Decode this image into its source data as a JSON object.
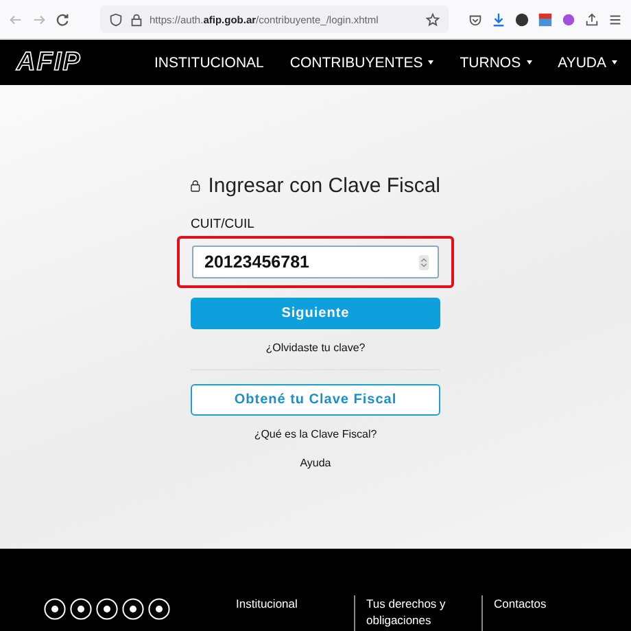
{
  "browser": {
    "url": "https://auth.**afip.gob.ar**/contribuyente_/login.xhtml"
  },
  "nav": {
    "logo": "AFIP",
    "items": [
      {
        "label": "INSTITUCIONAL",
        "dropdown": false
      },
      {
        "label": "CONTRIBUYENTES",
        "dropdown": true
      },
      {
        "label": "TURNOS",
        "dropdown": true
      },
      {
        "label": "AYUDA",
        "dropdown": true
      }
    ]
  },
  "login": {
    "title": "Ingresar con Clave Fiscal",
    "field_label": "CUIT/CUIL",
    "value": "20123456781",
    "highlighted": true,
    "submit": "Siguiente",
    "forgot": "¿Olvidaste tu clave?",
    "get_key": "Obtené tu Clave Fiscal",
    "what_is": "¿Qué es la Clave Fiscal?",
    "help": "Ayuda"
  },
  "footer": {
    "columns": [
      [
        "Institucional"
      ],
      [
        "Tus derechos y obligaciones"
      ],
      [
        "Contactos"
      ]
    ]
  }
}
